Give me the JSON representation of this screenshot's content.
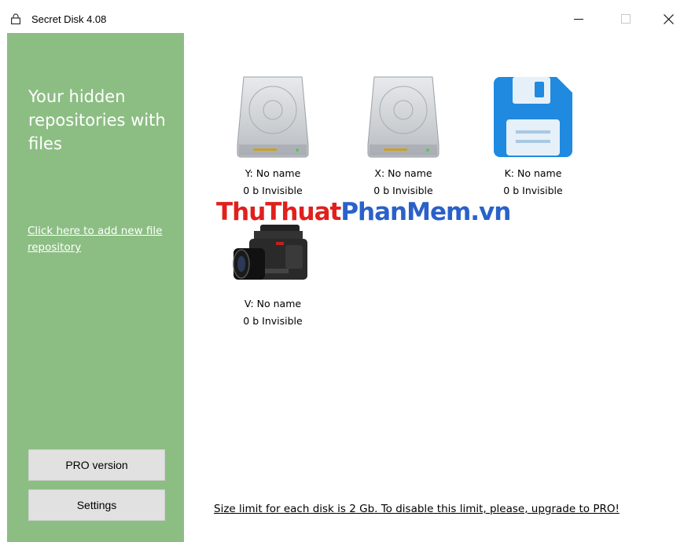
{
  "window": {
    "title": "Secret Disk 4.08",
    "controls": {
      "minimize": "—",
      "maximize": "☐",
      "close": "✕"
    }
  },
  "sidebar": {
    "heading": "Your hidden repositories with files",
    "add_link": "Click here to add new file repository",
    "pro_button": "PRO version",
    "settings_button": "Settings",
    "background_color": "#8cbe84"
  },
  "disks": [
    {
      "name": "Y: No name",
      "info": "0 b Invisible",
      "icon": "hard-drive-icon"
    },
    {
      "name": "X: No name",
      "info": "0 b Invisible",
      "icon": "hard-drive-icon"
    },
    {
      "name": "K: No name",
      "info": "0 b Invisible",
      "icon": "floppy-disk-icon"
    },
    {
      "name": "V: No name",
      "info": "0 b Invisible",
      "icon": "video-camera-icon"
    }
  ],
  "watermark": {
    "part1": "ThuThuat",
    "part2": "PhanMem",
    "part3": ".vn"
  },
  "footer": {
    "limit_note": "Size limit for each disk is 2 Gb. To disable this limit, please, upgrade to PRO!"
  }
}
